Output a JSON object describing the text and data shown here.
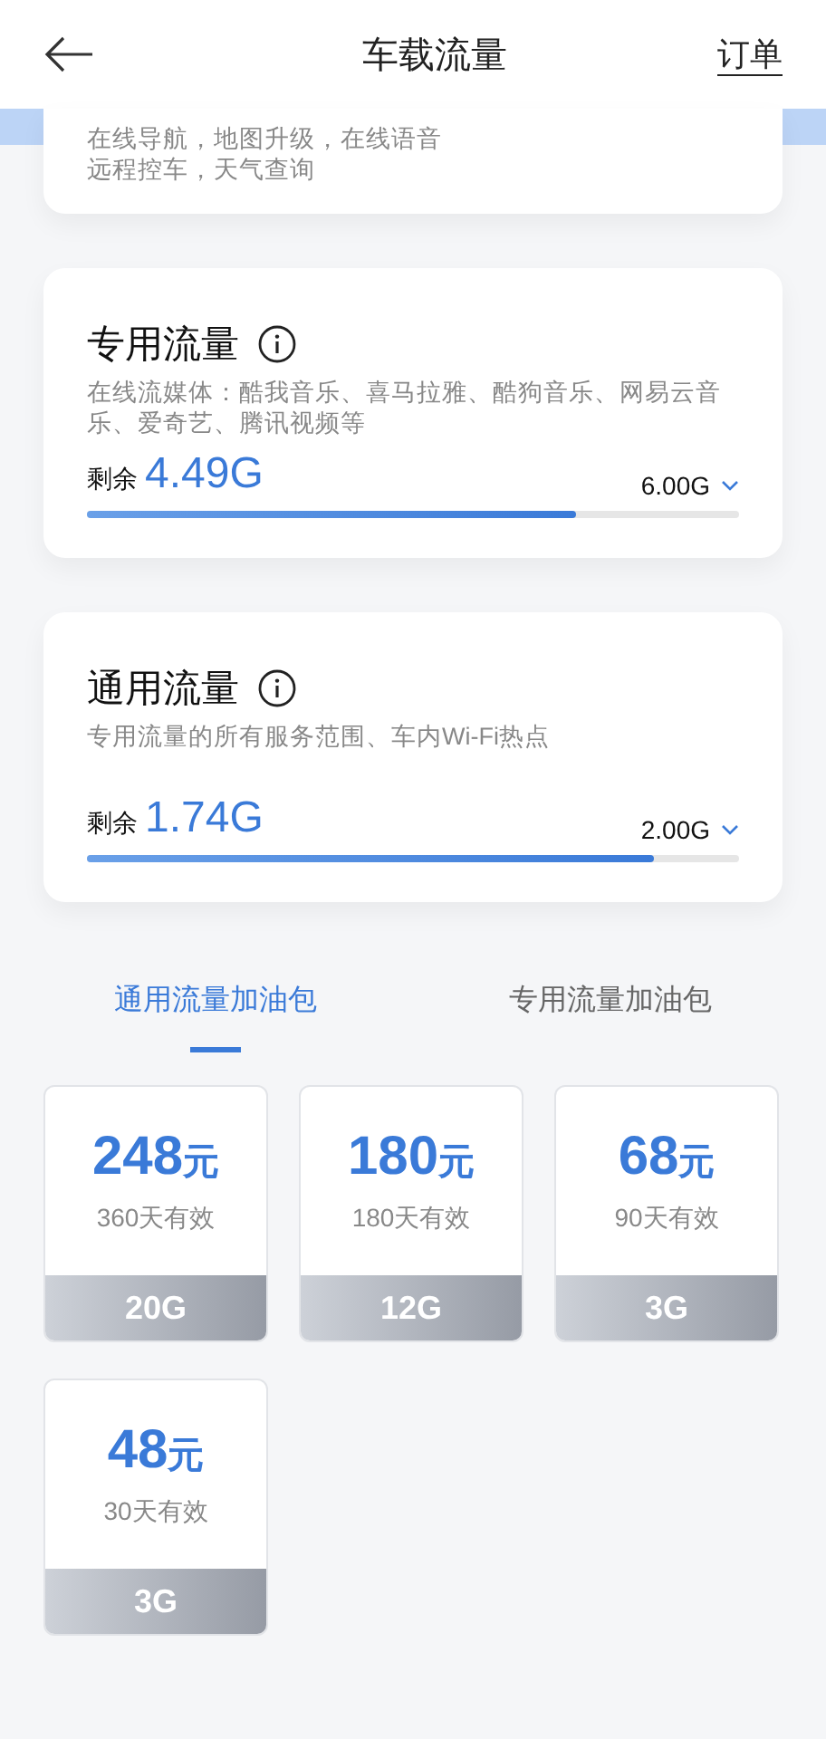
{
  "header": {
    "title": "车载流量",
    "action": "订单"
  },
  "basic_card": {
    "description_lines": [
      "在线导航，地图升级，在线语音",
      "远程控车，天气查询"
    ]
  },
  "quota_cards": [
    {
      "title": "专用流量",
      "description": "在线流媒体：酷我音乐、喜马拉雅、酷狗音乐、网易云音乐、爱奇艺、腾讯视频等",
      "remaining_label": "剩余",
      "remaining": "4.49G",
      "total": "6.00G",
      "level": 0.75
    },
    {
      "title": "通用流量",
      "description": "专用流量的所有服务范围、车内Wi-Fi热点",
      "remaining_label": "剩余",
      "remaining": "1.74G",
      "total": "2.00G",
      "level": 0.87
    }
  ],
  "tabs": [
    {
      "label": "通用流量加油包",
      "selected": true
    },
    {
      "label": "专用流量加油包",
      "selected": false
    }
  ],
  "packages": [
    {
      "price": "248",
      "unit": "元",
      "validity": "360天有效",
      "size": "20G"
    },
    {
      "price": "180",
      "unit": "元",
      "validity": "180天有效",
      "size": "12G"
    },
    {
      "price": "68",
      "unit": "元",
      "validity": "90天有效",
      "size": "3G"
    },
    {
      "price": "48",
      "unit": "元",
      "validity": "30天有效",
      "size": "3G"
    }
  ]
}
